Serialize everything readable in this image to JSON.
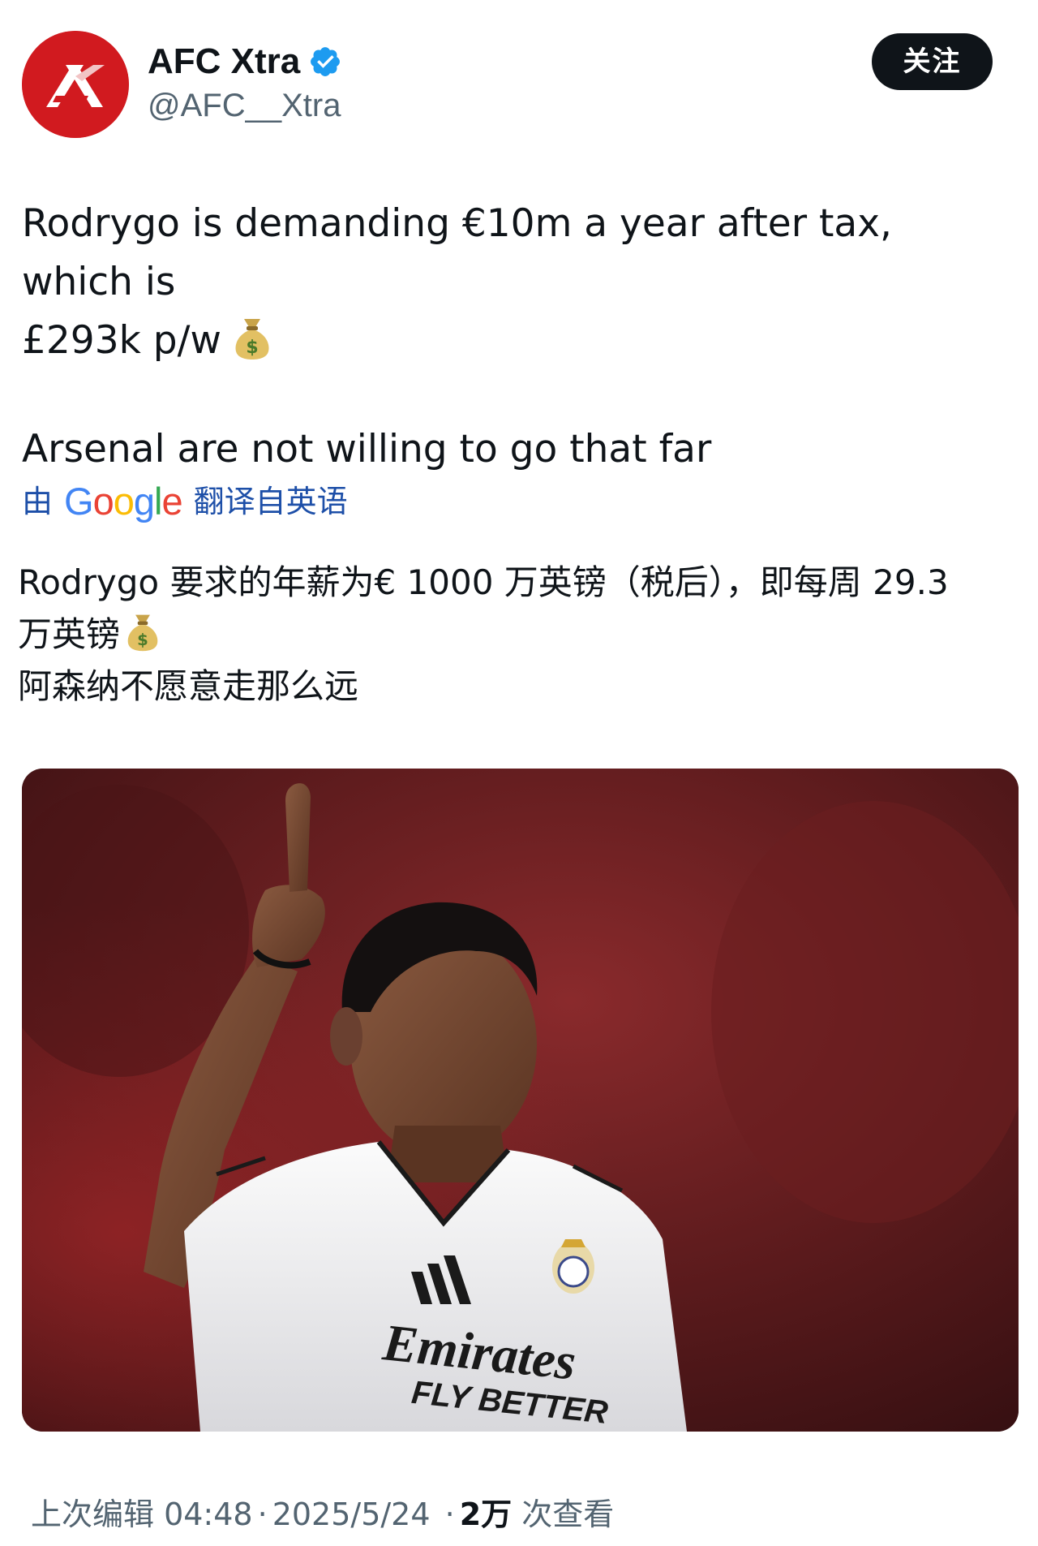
{
  "author": {
    "display_name": "AFC Xtra",
    "handle": "@AFC__Xtra",
    "avatar_icon": "afc-xtra-logo-icon",
    "verified_icon": "verified-badge-icon",
    "brand_color": "#d11a1f",
    "verified_color": "#1d9bf0"
  },
  "follow_button": {
    "label": "关注"
  },
  "tweet": {
    "line_1": "Rodrygo is demanding €10m a year after tax, which is",
    "line_2": "£293k p/w",
    "line_3": "Arsenal are not willing to go that far",
    "emoji_icon": "money-bag-icon"
  },
  "translation_notice": {
    "prefix": "由",
    "google": "Google",
    "suffix": "翻译自英语"
  },
  "translation": {
    "line_1": "Rodrygo 要求的年薪为€ 1000 万英镑（税后），即每周 29.3",
    "line_2": "万英镑",
    "line_3": "阿森纳不愿意走那么远"
  },
  "media": {
    "icon": "player-photo-image",
    "kit_sponsor": "Emirates",
    "kit_slogan": "FLY BETTER"
  },
  "meta": {
    "edited_label": "上次编辑 04:48",
    "separator": "·",
    "date": "2025/5/24",
    "views_count": "2万",
    "views_label": "次查看"
  }
}
